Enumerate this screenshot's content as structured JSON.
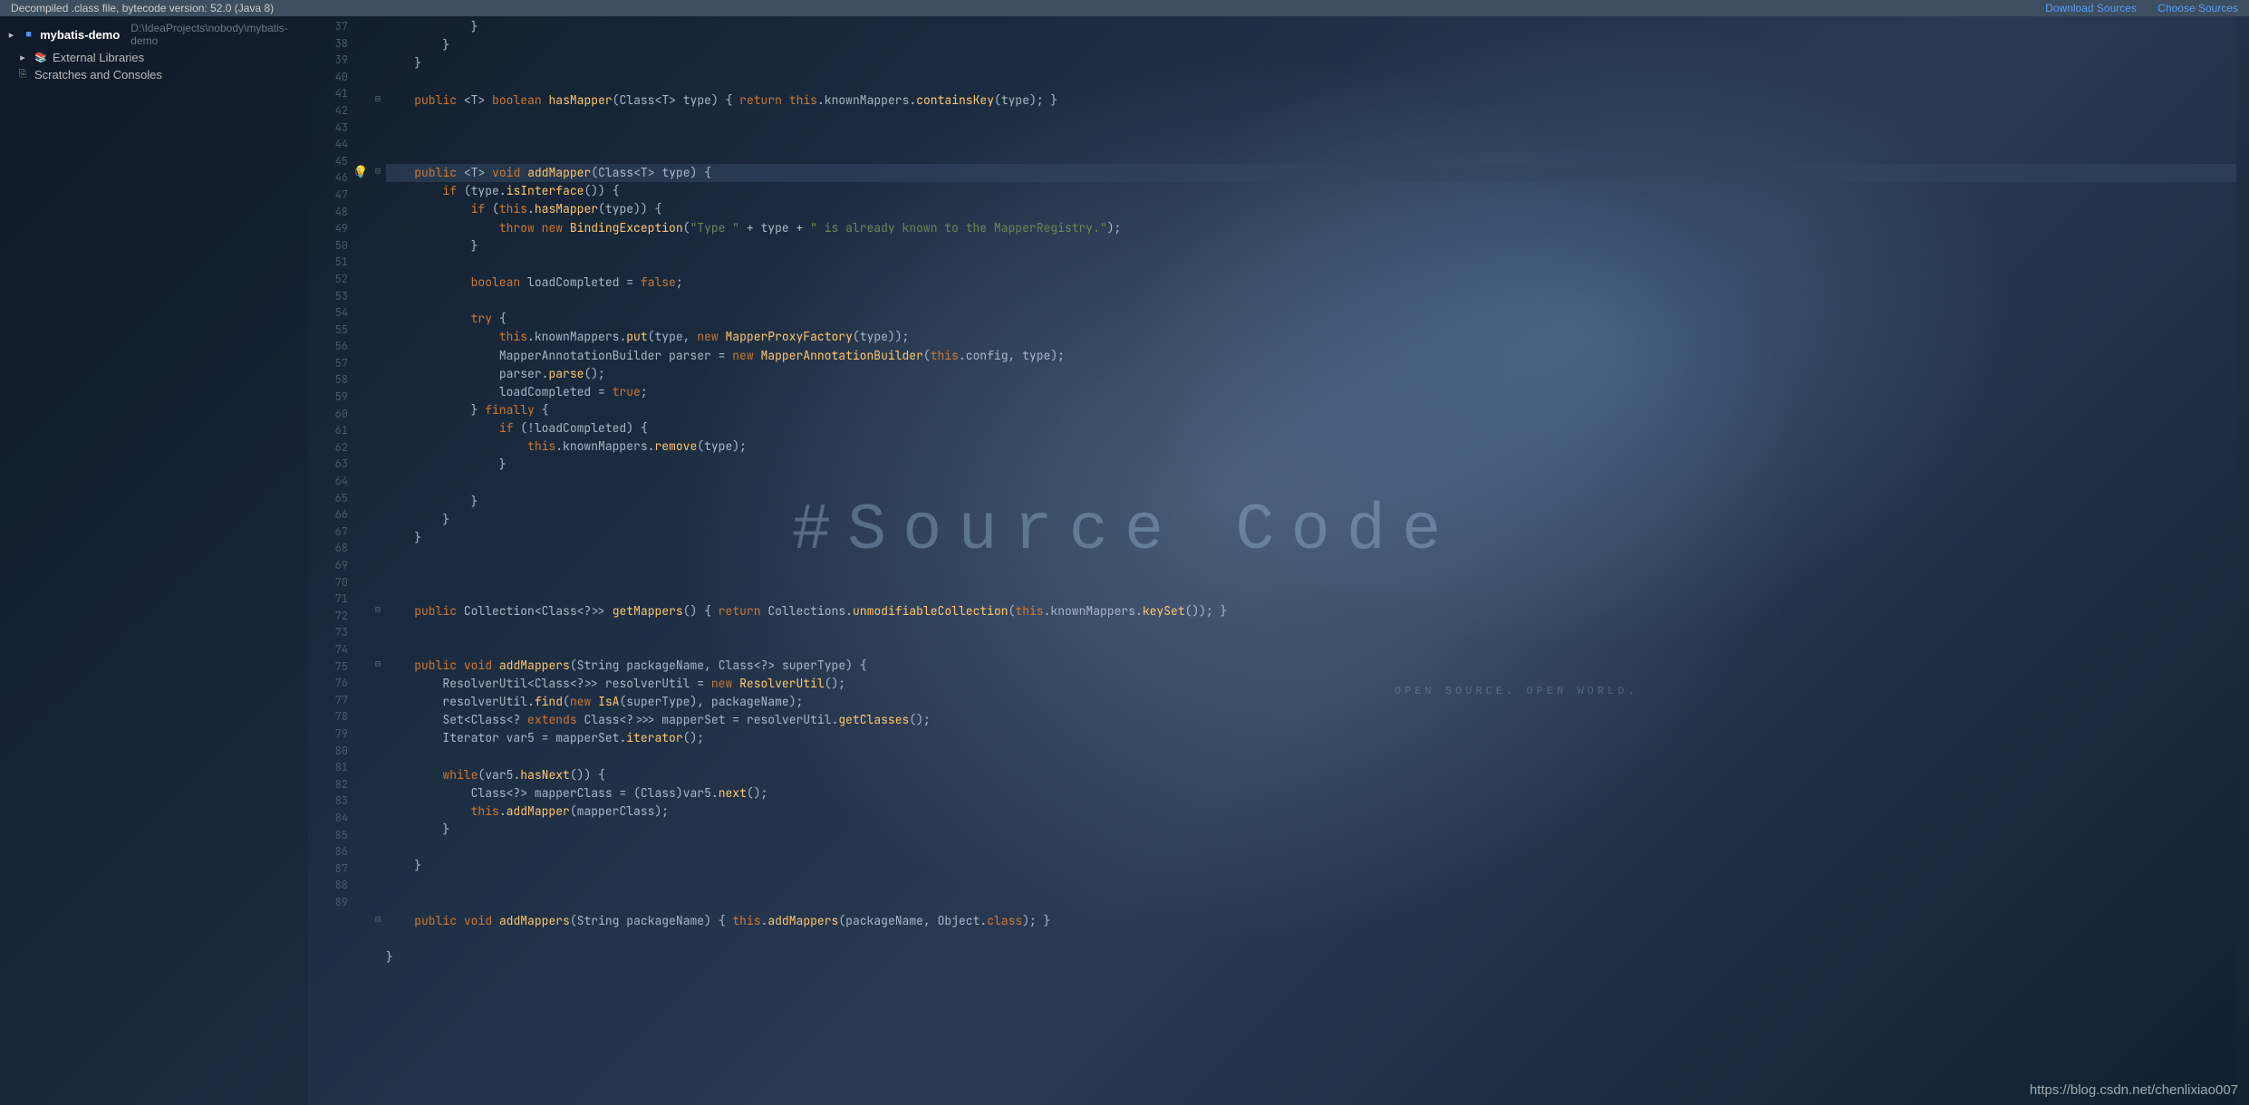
{
  "banner": {
    "text": "Decompiled .class file, bytecode version: 52.0 (Java 8)",
    "link_download": "Download Sources",
    "link_choose": "Choose Sources"
  },
  "sidebar": {
    "root": {
      "label": "mybatis-demo",
      "path": "D:\\IdeaProjects\\nobody\\mybatis-demo"
    },
    "ext_libs": "External Libraries",
    "scratches": "Scratches and Consoles"
  },
  "gutter": {
    "start": 37,
    "end": 89,
    "bulb_line": 45,
    "current_line": 45
  },
  "code_lines": [
    {
      "n": 37,
      "t": "            }"
    },
    {
      "n": 38,
      "t": "        }"
    },
    {
      "n": 39,
      "t": "    }"
    },
    {
      "n": 40,
      "t": ""
    },
    {
      "n": 41,
      "t": "    public <T> boolean hasMapper(Class<T> type) { return this.knownMappers.containsKey(type); }"
    },
    {
      "n": 42,
      "t": ""
    },
    {
      "n": 43,
      "t": ""
    },
    {
      "n": 44,
      "t": ""
    },
    {
      "n": 45,
      "t": "    public <T> void addMapper(Class<T> type) {"
    },
    {
      "n": 46,
      "t": "        if (type.isInterface()) {"
    },
    {
      "n": 47,
      "t": "            if (this.hasMapper(type)) {"
    },
    {
      "n": 48,
      "t": "                throw new BindingException(\"Type \" + type + \" is already known to the MapperRegistry.\");"
    },
    {
      "n": 49,
      "t": "            }"
    },
    {
      "n": 50,
      "t": ""
    },
    {
      "n": 51,
      "t": "            boolean loadCompleted = false;"
    },
    {
      "n": 52,
      "t": ""
    },
    {
      "n": 53,
      "t": "            try {"
    },
    {
      "n": 54,
      "t": "                this.knownMappers.put(type, new MapperProxyFactory(type));"
    },
    {
      "n": 55,
      "t": "                MapperAnnotationBuilder parser = new MapperAnnotationBuilder(this.config, type);"
    },
    {
      "n": 56,
      "t": "                parser.parse();"
    },
    {
      "n": 57,
      "t": "                loadCompleted = true;"
    },
    {
      "n": 58,
      "t": "            } finally {"
    },
    {
      "n": 59,
      "t": "                if (!loadCompleted) {"
    },
    {
      "n": 60,
      "t": "                    this.knownMappers.remove(type);"
    },
    {
      "n": 61,
      "t": "                }"
    },
    {
      "n": 62,
      "t": ""
    },
    {
      "n": 63,
      "t": "            }"
    },
    {
      "n": 64,
      "t": "        }"
    },
    {
      "n": 65,
      "t": "    }"
    },
    {
      "n": 66,
      "t": ""
    },
    {
      "n": 67,
      "t": ""
    },
    {
      "n": 68,
      "t": ""
    },
    {
      "n": 69,
      "t": "    public Collection<Class<?>> getMappers() { return Collections.unmodifiableCollection(this.knownMappers.keySet()); }"
    },
    {
      "n": 70,
      "t": ""
    },
    {
      "n": 71,
      "t": ""
    },
    {
      "n": 72,
      "t": "    public void addMappers(String packageName, Class<?> superType) {"
    },
    {
      "n": 73,
      "t": "        ResolverUtil<Class<?>> resolverUtil = new ResolverUtil();"
    },
    {
      "n": 74,
      "t": "        resolverUtil.find(new IsA(superType), packageName);"
    },
    {
      "n": 75,
      "t": "        Set<Class<? extends Class<?>>> mapperSet = resolverUtil.getClasses();"
    },
    {
      "n": 76,
      "t": "        Iterator var5 = mapperSet.iterator();"
    },
    {
      "n": 77,
      "t": ""
    },
    {
      "n": 78,
      "t": "        while(var5.hasNext()) {"
    },
    {
      "n": 79,
      "t": "            Class<?> mapperClass = (Class)var5.next();"
    },
    {
      "n": 80,
      "t": "            this.addMapper(mapperClass);"
    },
    {
      "n": 81,
      "t": "        }"
    },
    {
      "n": 82,
      "t": ""
    },
    {
      "n": 83,
      "t": "    }"
    },
    {
      "n": 84,
      "t": ""
    },
    {
      "n": 85,
      "t": ""
    },
    {
      "n": 86,
      "t": "    public void addMappers(String packageName) { this.addMappers(packageName, Object.class); }"
    },
    {
      "n": 87,
      "t": ""
    },
    {
      "n": 88,
      "t": "}"
    },
    {
      "n": 89,
      "t": ""
    }
  ],
  "watermark": {
    "big": "#Source Code",
    "sub": "OPEN SOURCE. OPEN WORLD.",
    "url": "https://blog.csdn.net/chenlixiao007"
  }
}
